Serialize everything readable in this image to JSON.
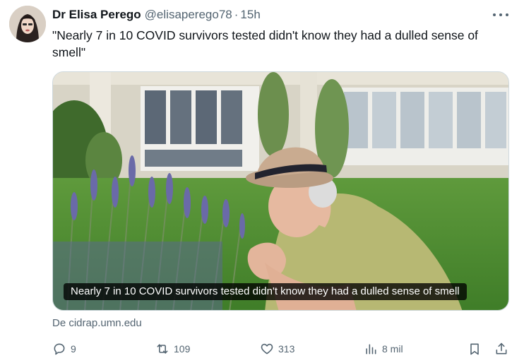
{
  "tweet": {
    "author_name": "Dr Elisa Perego",
    "author_handle": "@elisaperego78",
    "separator": "·",
    "time": "15h",
    "text": "\"Nearly 7 in 10 COVID survivors tested didn't know they had a dulled sense of smell\""
  },
  "media": {
    "caption": "Nearly 7 in 10 COVID survivors tested didn't know they had a dulled sense of smell"
  },
  "link_source": "De cidrap.umn.edu",
  "actions": {
    "replies": "9",
    "reposts": "109",
    "likes": "313",
    "views": "8 mil"
  },
  "icons": {
    "reply": "reply-icon",
    "repost": "repost-icon",
    "like": "heart-icon",
    "views": "views-chart-icon",
    "bookmark": "bookmark-icon",
    "share": "share-icon",
    "more": "more-dots-icon"
  },
  "colors": {
    "text_primary": "#0f1419",
    "text_secondary": "#536471",
    "border": "#cfd9de"
  }
}
